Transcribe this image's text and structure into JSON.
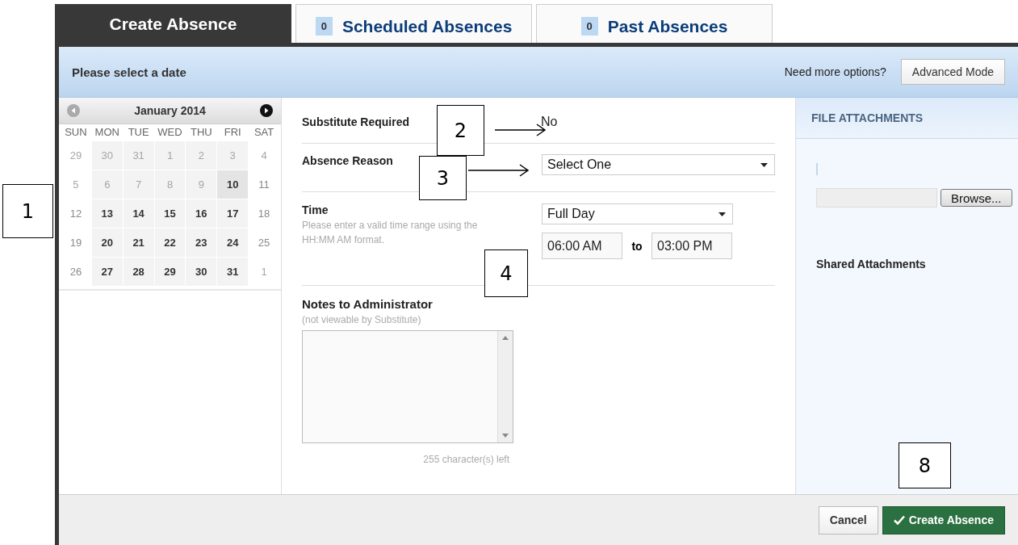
{
  "tabs": [
    {
      "label": "Create Absence",
      "selected": true
    },
    {
      "label": "Scheduled Absences",
      "count": "0",
      "selected": false
    },
    {
      "label": "Past Absences",
      "count": "0",
      "selected": false
    }
  ],
  "header": {
    "title": "Please select a date",
    "hint": "Need more options?",
    "button": "Advanced Mode"
  },
  "calendar": {
    "month": "January 2014",
    "weekdays": [
      "SUN",
      "MON",
      "TUE",
      "WED",
      "THU",
      "FRI",
      "SAT"
    ],
    "weeks": [
      [
        {
          "day": "29",
          "kind": "muted",
          "highlighted": false
        },
        {
          "day": "30",
          "kind": "muted",
          "highlighted": false
        },
        {
          "day": "31",
          "kind": "muted",
          "highlighted": false
        },
        {
          "day": "1",
          "kind": "muted",
          "highlighted": false
        },
        {
          "day": "2",
          "kind": "muted",
          "highlighted": false
        },
        {
          "day": "3",
          "kind": "muted",
          "highlighted": false
        },
        {
          "day": "4",
          "kind": "muted",
          "highlighted": false
        }
      ],
      [
        {
          "day": "5",
          "kind": "muted",
          "highlighted": false
        },
        {
          "day": "6",
          "kind": "muted",
          "highlighted": false
        },
        {
          "day": "7",
          "kind": "muted",
          "highlighted": false
        },
        {
          "day": "8",
          "kind": "muted",
          "highlighted": false
        },
        {
          "day": "9",
          "kind": "muted",
          "highlighted": false
        },
        {
          "day": "10",
          "kind": "available",
          "highlighted": true
        },
        {
          "day": "11",
          "kind": "weekend",
          "highlighted": false
        }
      ],
      [
        {
          "day": "12",
          "kind": "weekend",
          "highlighted": false
        },
        {
          "day": "13",
          "kind": "available",
          "highlighted": false
        },
        {
          "day": "14",
          "kind": "available",
          "highlighted": false
        },
        {
          "day": "15",
          "kind": "available",
          "highlighted": false
        },
        {
          "day": "16",
          "kind": "available",
          "highlighted": false
        },
        {
          "day": "17",
          "kind": "available",
          "highlighted": false
        },
        {
          "day": "18",
          "kind": "weekend",
          "highlighted": false
        }
      ],
      [
        {
          "day": "19",
          "kind": "weekend",
          "highlighted": false
        },
        {
          "day": "20",
          "kind": "available",
          "highlighted": false
        },
        {
          "day": "21",
          "kind": "available",
          "highlighted": false
        },
        {
          "day": "22",
          "kind": "available",
          "highlighted": false
        },
        {
          "day": "23",
          "kind": "available",
          "highlighted": false
        },
        {
          "day": "24",
          "kind": "available",
          "highlighted": false
        },
        {
          "day": "25",
          "kind": "weekend",
          "highlighted": false
        }
      ],
      [
        {
          "day": "26",
          "kind": "weekend",
          "highlighted": false
        },
        {
          "day": "27",
          "kind": "available",
          "highlighted": false
        },
        {
          "day": "28",
          "kind": "available",
          "highlighted": false
        },
        {
          "day": "29",
          "kind": "available",
          "highlighted": false
        },
        {
          "day": "30",
          "kind": "available",
          "highlighted": false
        },
        {
          "day": "31",
          "kind": "available",
          "highlighted": false
        },
        {
          "day": "1",
          "kind": "muted",
          "highlighted": false
        }
      ]
    ]
  },
  "form": {
    "substitute_label": "Substitute Required",
    "substitute_value": "No",
    "reason_label": "Absence Reason",
    "reason_select": "Select One",
    "time_label": "Time",
    "time_hint": "Please enter a valid time range using the HH:MM AM format.",
    "time_select": "Full Day",
    "start": "06:00 AM",
    "to": "to",
    "end": "03:00 PM",
    "notes_label": "Notes to Administrator",
    "notes_hint": "(not viewable by Substitute)",
    "chars_left": "255 character(s) left"
  },
  "attachments": {
    "title": "FILE ATTACHMENTS",
    "browse": "Browse...",
    "shared_title": "Shared Attachments"
  },
  "footer": {
    "buttons": [
      {
        "label": "Cancel",
        "kind": "secondary"
      },
      {
        "label": "Create Absence",
        "kind": "primary"
      }
    ]
  },
  "callouts": [
    {
      "label": "1"
    },
    {
      "label": "2"
    },
    {
      "label": "3"
    },
    {
      "label": "4"
    },
    {
      "label": "8"
    }
  ]
}
